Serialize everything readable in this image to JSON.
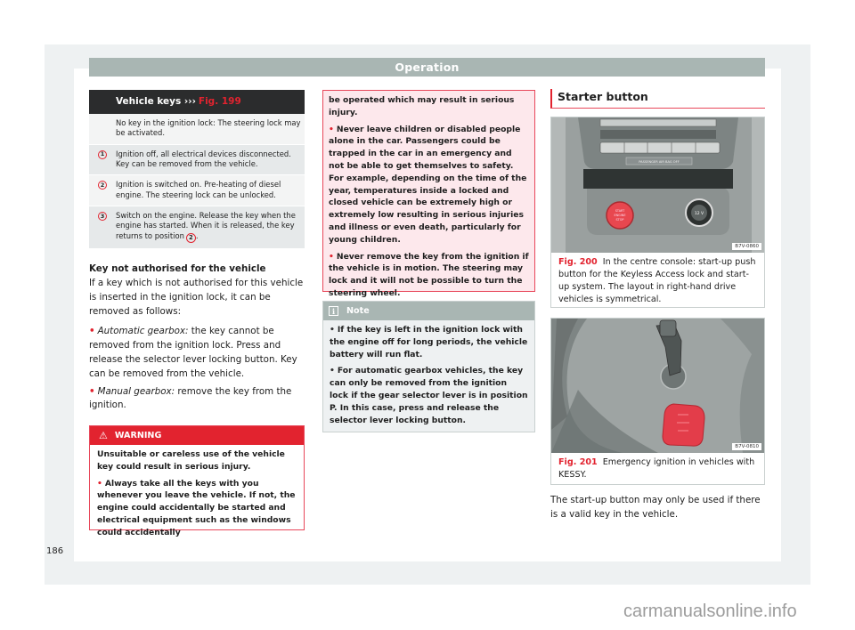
{
  "header": {
    "section": "Operation"
  },
  "page_number": "186",
  "watermark": "carmanualsonline.info",
  "keys_table": {
    "title": "Vehicle keys",
    "ref_arrows": "›››",
    "fig_ref": "Fig. 199",
    "rows": [
      {
        "num": "",
        "text": "No key in the ignition lock: The steering lock may be activated."
      },
      {
        "num": "1",
        "text": "Ignition off, all electrical devices disconnected. Key can be removed from the vehicle."
      },
      {
        "num": "2",
        "text": "Ignition is switched on. Pre-heating of diesel engine. The steering lock can be unlocked."
      },
      {
        "num": "3",
        "text": "Switch on the engine. Release the key when the engine has started. When it is released, the key returns to position",
        "ref": "2",
        "suffix": "."
      }
    ]
  },
  "unauthorised": {
    "heading": "Key not authorised for the vehicle",
    "intro": "If a key which is not authorised for this vehicle is inserted in the ignition lock, it can be removed as follows:",
    "bullets": [
      {
        "label": "Automatic gearbox:",
        "text": " the key cannot be removed from the ignition lock. Press and release the selector lever locking button. Key can be removed from the vehicle."
      },
      {
        "label": "Manual gearbox:",
        "text": " remove the key from the ignition."
      }
    ]
  },
  "warning": {
    "icon": "warning-triangle-icon",
    "title": "WARNING",
    "lead": "Unsuitable or careless use of the vehicle key could result in serious injury.",
    "bullet1_start": "Always take all the keys with you whenever you leave the vehicle. If not, the engine could accidentally be started and electrical equipment such as the windows could accidentally",
    "bullet1_end": "be operated which may result in serious injury.",
    "bullet2": "Never leave children or disabled people alone in the car. Passengers could be trapped in the car in an emergency and not be able to get themselves to safety. For example, depending on the time of the year, temperatures inside a locked and closed vehicle can be extremely high or extremely low resulting in serious injuries and illness or even death, particularly for young children.",
    "bullet3": "Never remove the key from the ignition if the vehicle is in motion. The steering may lock and it will not be possible to turn the steering wheel."
  },
  "note": {
    "icon": "info-icon",
    "title": "Note",
    "bullets": [
      "If the key is left in the ignition lock with the engine off for long periods, the vehicle battery will run flat.",
      "For automatic gearbox vehicles, the key can only be removed from the ignition lock if the gear selector lever is in position P. In this case, press and release the selector lever locking button."
    ]
  },
  "starter": {
    "title": "Starter button",
    "fig200": {
      "code": "B7V-0860",
      "num": "Fig. 200",
      "caption": "In the centre console: start-up push button for the Keyless Access lock and start-up system. The layout in right-hand drive vehicles is symmetrical.",
      "labels": {
        "airbag": "PASSENGER AIR BAG OFF",
        "start": [
          "START",
          "ENGINE",
          "STOP"
        ],
        "socket": "12 V"
      }
    },
    "fig201": {
      "code": "B7V-0810",
      "num": "Fig. 201",
      "caption": "Emergency ignition in vehicles with KESSY."
    },
    "body": "The start-up button may only be used if there is a valid key in the vehicle."
  }
}
